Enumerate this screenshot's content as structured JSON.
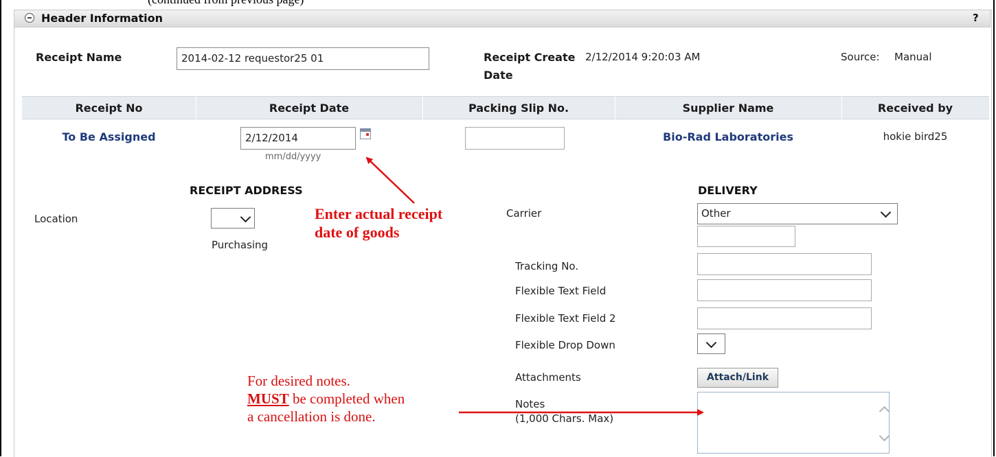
{
  "top_clip": "(continued from previous page)",
  "header": {
    "title": "Header Information",
    "help": "?"
  },
  "receipt": {
    "name_label": "Receipt Name",
    "name_value": "2014-02-12 requestor25 01",
    "create_label_1": "Receipt Create",
    "create_label_2": "Date",
    "create_value": "2/12/2014 9:20:03 AM",
    "source_label": "Source:",
    "source_value": "Manual"
  },
  "table": {
    "columns": [
      "Receipt No",
      "Receipt Date",
      "Packing Slip No.",
      "Supplier Name",
      "Received by"
    ],
    "row": {
      "receipt_no": "To Be Assigned",
      "receipt_date": "2/12/2014",
      "date_hint": "mm/dd/yyyy",
      "packing_slip": "",
      "supplier": "Bio-Rad Laboratories",
      "received_by": "hokie bird25"
    }
  },
  "address": {
    "title": "RECEIPT ADDRESS",
    "location_label": "Location",
    "location_value": "",
    "location_text": "Purchasing"
  },
  "delivery": {
    "title": "DELIVERY",
    "carrier_label": "Carrier",
    "carrier_value": "Other",
    "carrier_other": "",
    "tracking_label": "Tracking No.",
    "tracking_value": "",
    "flex1_label": "Flexible Text Field",
    "flex1_value": "",
    "flex2_label": "Flexible Text Field 2",
    "flex2_value": "",
    "flexdd_label": "Flexible Drop Down",
    "flexdd_value": "",
    "attach_label": "Attachments",
    "attach_button": "Attach/Link",
    "notes_label": "Notes",
    "notes_hint": "(1,000 Chars. Max)",
    "notes_value": ""
  },
  "annotations": {
    "date_note_1": "Enter actual receipt",
    "date_note_2": "date of goods",
    "notes_note_1": "For desired notes.",
    "notes_note_must": "MUST",
    "notes_note_2": " be completed when",
    "notes_note_3": "a cancellation is done."
  },
  "colors": {
    "annotation_red": "#e01010",
    "link_blue": "#1f3a7a",
    "table_header": "#e7ecf1"
  }
}
